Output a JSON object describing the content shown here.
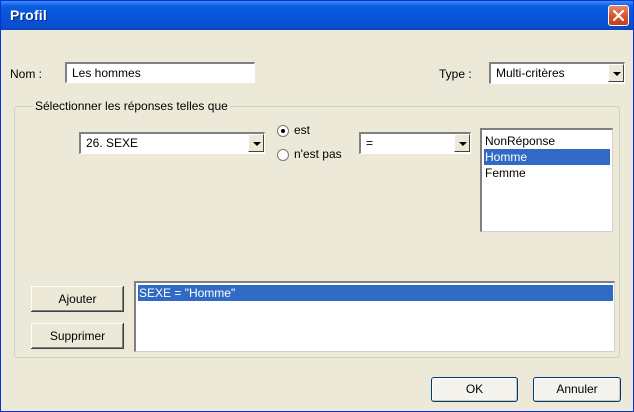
{
  "window": {
    "title": "Profil"
  },
  "name_field": {
    "label": "Nom :",
    "value": "Les hommes"
  },
  "type_field": {
    "label": "Type :",
    "value": "Multi-critères"
  },
  "group": {
    "label": "Sélectionner les réponses telles que"
  },
  "question_combo": {
    "value": "26. SEXE"
  },
  "condition": {
    "options": [
      {
        "label": "est",
        "checked": true
      },
      {
        "label": "n'est pas",
        "checked": false
      }
    ]
  },
  "operator_combo": {
    "value": "="
  },
  "responses": {
    "items": [
      {
        "label": "NonRéponse",
        "selected": false
      },
      {
        "label": "Homme",
        "selected": true
      },
      {
        "label": "Femme",
        "selected": false
      }
    ]
  },
  "criteria": {
    "items": [
      {
        "label": "SEXE = \"Homme\"",
        "selected": true
      }
    ]
  },
  "buttons": {
    "add": "Ajouter",
    "remove": "Supprimer",
    "ok": "OK",
    "cancel": "Annuler"
  },
  "colors": {
    "titlebar": "#0654d8",
    "selection": "#316ac5",
    "dialog_bg": "#ece9d8",
    "close": "#d9512c"
  },
  "icons": {
    "close": "close-icon",
    "dropdown": "chevron-down-icon"
  }
}
